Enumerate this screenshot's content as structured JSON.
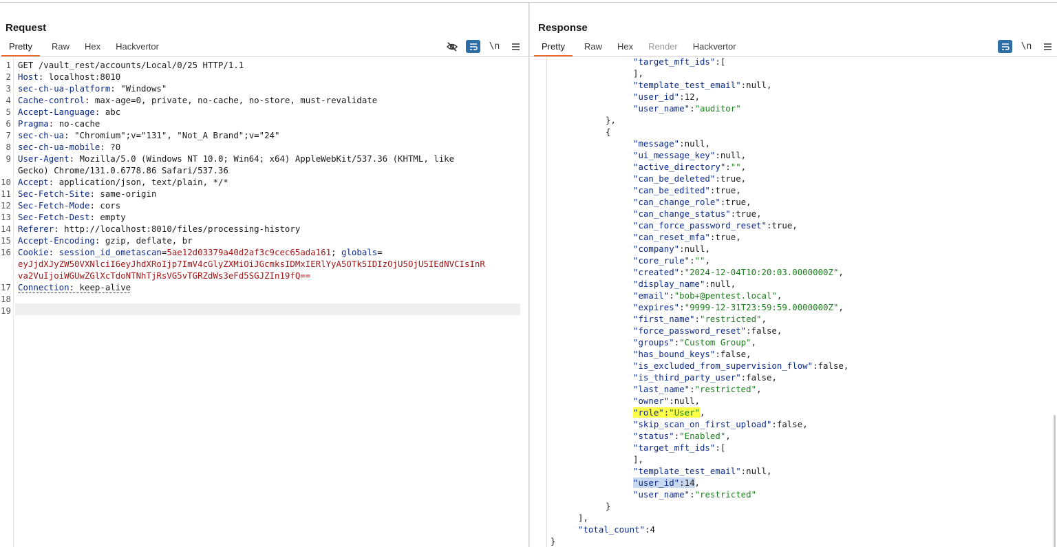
{
  "request": {
    "title": "Request",
    "tabs": [
      "Pretty",
      "Raw",
      "Hex",
      "Hackvertor"
    ],
    "active_tab": "Pretty",
    "toolbar": {
      "wrap_label": "\\n"
    },
    "lines": [
      {
        "n": "1",
        "text": "GET /vault_rest/accounts/Local/0/25 HTTP/1.1"
      },
      {
        "n": "2",
        "k": "Host",
        "v": " localhost:8010"
      },
      {
        "n": "3",
        "k": "sec-ch-ua-platform",
        "v": " \"Windows\""
      },
      {
        "n": "4",
        "k": "Cache-control",
        "v": " max-age=0, private, no-cache, no-store, must-revalidate"
      },
      {
        "n": "5",
        "k": "Accept-Language",
        "v": " abc"
      },
      {
        "n": "6",
        "k": "Pragma",
        "v": " no-cache"
      },
      {
        "n": "7",
        "k": "sec-ch-ua",
        "v": " \"Chromium\";v=\"131\", \"Not_A Brand\";v=\"24\""
      },
      {
        "n": "8",
        "k": "sec-ch-ua-mobile",
        "v": " ?0"
      },
      {
        "n": "9",
        "k": "User-Agent",
        "v": " Mozilla/5.0 (Windows NT 10.0; Win64; x64) AppleWebKit/537.36 (KHTML, like"
      },
      {
        "n": "",
        "text": "Gecko) Chrome/131.0.6778.86 Safari/537.36"
      },
      {
        "n": "10",
        "k": "Accept",
        "v": " application/json, text/plain, */*"
      },
      {
        "n": "11",
        "k": "Sec-Fetch-Site",
        "v": " same-origin"
      },
      {
        "n": "12",
        "k": "Sec-Fetch-Mode",
        "v": " cors"
      },
      {
        "n": "13",
        "k": "Sec-Fetch-Dest",
        "v": " empty"
      },
      {
        "n": "14",
        "k": "Referer",
        "v": " http://localhost:8010/files/processing-history"
      },
      {
        "n": "15",
        "k": "Accept-Encoding",
        "v": " gzip, deflate, br"
      },
      {
        "n": "16",
        "cookie": true,
        "k": "Cookie",
        "c1k": "session_id_ometascan",
        "c1v": "5ae12d03379a40d2af3c9cec65ada161",
        "c2k": "globals"
      },
      {
        "n": "",
        "cookiecont": "eyJjdXJyZW50VXNlciI6eyJhdXRoIjp7ImV4cGlyZXMiOiJGcmksIDMxIERlYyA5OTk5IDIzOjU5OjU5IEdNVCIsInR"
      },
      {
        "n": "",
        "cookiecont": "va2VuIjoiWGUwZGlXcTdoNTNhTjRsVG5vTGRZdWs3eFd5SGJZIn19fQ=="
      },
      {
        "n": "17",
        "k": "Connection",
        "v": " keep-alive",
        "dotted": true
      },
      {
        "n": "18",
        "text": ""
      },
      {
        "n": "19",
        "text": ""
      }
    ]
  },
  "response": {
    "title": "Response",
    "tabs": [
      "Pretty",
      "Raw",
      "Hex",
      "Render",
      "Hackvertor"
    ],
    "active_tab": "Pretty",
    "disabled_tab": "Render",
    "toolbar": {
      "wrap_label": "\\n"
    },
    "lines": [
      {
        "i": 3,
        "k": "target_mft_ids",
        "p": ":["
      },
      {
        "i": 3,
        "raw": "],"
      },
      {
        "i": 3,
        "k": "template_test_email",
        "p": ":",
        "n": "null",
        "t": ","
      },
      {
        "i": 3,
        "k": "user_id",
        "p": ":",
        "n": "12",
        "t": ","
      },
      {
        "i": 3,
        "k": "user_name",
        "p": ":",
        "s": "auditor"
      },
      {
        "i": 2,
        "raw": "},"
      },
      {
        "i": 2,
        "raw": "{"
      },
      {
        "i": 3,
        "k": "message",
        "p": ":",
        "n": "null",
        "t": ","
      },
      {
        "i": 3,
        "k": "ui_message_key",
        "p": ":",
        "n": "null",
        "t": ","
      },
      {
        "i": 3,
        "k": "active_directory",
        "p": ":",
        "s": "",
        "t": ","
      },
      {
        "i": 3,
        "k": "can_be_deleted",
        "p": ":",
        "n": "true",
        "t": ","
      },
      {
        "i": 3,
        "k": "can_be_edited",
        "p": ":",
        "n": "true",
        "t": ","
      },
      {
        "i": 3,
        "k": "can_change_role",
        "p": ":",
        "n": "true",
        "t": ","
      },
      {
        "i": 3,
        "k": "can_change_status",
        "p": ":",
        "n": "true",
        "t": ","
      },
      {
        "i": 3,
        "k": "can_force_password_reset",
        "p": ":",
        "n": "true",
        "t": ","
      },
      {
        "i": 3,
        "k": "can_reset_mfa",
        "p": ":",
        "n": "true",
        "t": ","
      },
      {
        "i": 3,
        "k": "company",
        "p": ":",
        "n": "null",
        "t": ","
      },
      {
        "i": 3,
        "k": "core_rule",
        "p": ":",
        "s": "",
        "t": ","
      },
      {
        "i": 3,
        "k": "created",
        "p": ":",
        "s": "2024-12-04T10:20:03.0000000Z",
        "t": ","
      },
      {
        "i": 3,
        "k": "display_name",
        "p": ":",
        "n": "null",
        "t": ","
      },
      {
        "i": 3,
        "k": "email",
        "p": ":",
        "s": "bob+@pentest.local",
        "t": ","
      },
      {
        "i": 3,
        "k": "expires",
        "p": ":",
        "s": "9999-12-31T23:59:59.0000000Z",
        "t": ","
      },
      {
        "i": 3,
        "k": "first_name",
        "p": ":",
        "s": "restricted",
        "t": ","
      },
      {
        "i": 3,
        "k": "force_password_reset",
        "p": ":",
        "n": "false",
        "t": ","
      },
      {
        "i": 3,
        "k": "groups",
        "p": ":",
        "s": "Custom Group",
        "t": ","
      },
      {
        "i": 3,
        "k": "has_bound_keys",
        "p": ":",
        "n": "false",
        "t": ","
      },
      {
        "i": 3,
        "k": "is_excluded_from_supervision_flow",
        "p": ":",
        "n": "false",
        "t": ","
      },
      {
        "i": 3,
        "k": "is_third_party_user",
        "p": ":",
        "n": "false",
        "t": ","
      },
      {
        "i": 3,
        "k": "last_name",
        "p": ":",
        "s": "restricted",
        "t": ","
      },
      {
        "i": 3,
        "k": "owner",
        "p": ":",
        "n": "null",
        "t": ","
      },
      {
        "i": 3,
        "k": "role",
        "p": ":",
        "s": "User",
        "t": ",",
        "hl": "yellow"
      },
      {
        "i": 3,
        "k": "skip_scan_on_first_upload",
        "p": ":",
        "n": "false",
        "t": ","
      },
      {
        "i": 3,
        "k": "status",
        "p": ":",
        "s": "Enabled",
        "t": ","
      },
      {
        "i": 3,
        "k": "target_mft_ids",
        "p": ":["
      },
      {
        "i": 3,
        "raw": "],"
      },
      {
        "i": 3,
        "k": "template_test_email",
        "p": ":",
        "n": "null",
        "t": ","
      },
      {
        "i": 3,
        "k": "user_id",
        "p": ":",
        "n": "14",
        "t": ",",
        "hl": "blue"
      },
      {
        "i": 3,
        "k": "user_name",
        "p": ":",
        "s": "restricted"
      },
      {
        "i": 2,
        "raw": "}"
      },
      {
        "i": 1,
        "raw": "],"
      },
      {
        "i": 1,
        "k": "total_count",
        "p": ":",
        "n": "4"
      },
      {
        "i": 0,
        "raw": "}"
      }
    ]
  },
  "colors": {
    "accent": "#2f6ea5",
    "tab_underline": "#e8692a",
    "string": "#1a7f1a",
    "key": "#0b2a8c",
    "cookie_value": "#a31515",
    "highlight_yellow": "#ffff4a",
    "highlight_blue": "#c8d8ee"
  }
}
